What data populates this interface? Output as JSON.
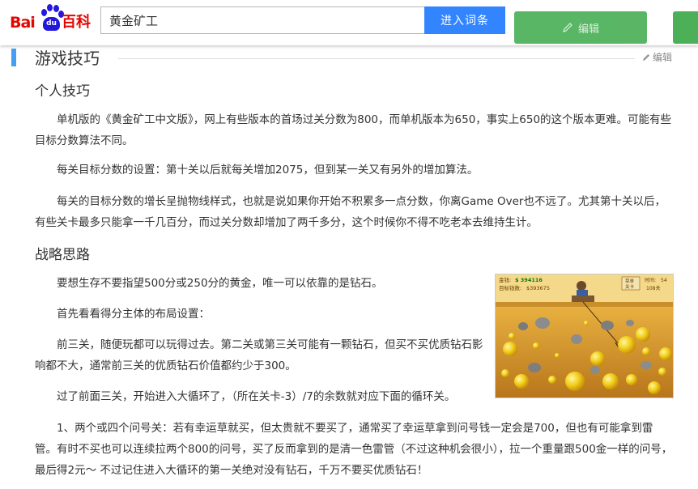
{
  "header": {
    "logo_left": "Bai",
    "logo_du": "du",
    "logo_right": "百科",
    "search_value": "黄金矿工",
    "search_button": "进入词条",
    "edit_button": "编辑"
  },
  "section": {
    "title": "游戏技巧",
    "edit_label": "编辑"
  },
  "subsections": [
    {
      "title": "个人技巧",
      "paragraphs": [
        "单机版的《黄金矿工中文版》，网上有些版本的首场过关分数为800，而单机版本为650，事实上650的这个版本更难。可能有些目标分数算法不同。",
        "每关目标分数的设置：第十关以后就每关增加2075，但到某一关又有另外的增加算法。",
        "每关的目标分数的增长呈抛物线样式，也就是说如果你开始不积累多一点分数，你离Game Over也不远了。尤其第十关以后，有些关卡最多只能拿一千几百分，而过关分数却增加了两千多分，这个时候你不得不吃老本去维持生计。"
      ]
    },
    {
      "title": "战略思路",
      "paragraphs": [
        "要想生存不要指望500分或250分的黄金，唯一可以依靠的是钻石。",
        "首先看看得分主体的布局设置：",
        "前三关，随便玩都可以玩得过去。第二关或第三关可能有一颗钻石，但买不买优质钻石影响都不大，通常前三关的优质钻石价值都约少于300。",
        "过了前面三关，开始进入大循环了，（所在关卡-3）/7的余数就对应下面的循环关。",
        "1、两个或四个问号关：若有幸运草就买，但太贵就不要买了，通常买了幸运草拿到问号钱一定会是700，但也有可能拿到雷管。有时不买也可以连续拉两个800的问号，买了反而拿到的是清一色雷管（不过这种机会很小），拉一个重量跟500金一样的问号，最后得2元～ 不过记住进入大循环的第一关绝对没有钻石，千万不要买优质钻石！"
      ]
    }
  ],
  "game_image": {
    "money_label": "金钱:",
    "money_value": "$ 394116",
    "goal_label": "目标钱数:",
    "goal_value": "$393675",
    "menu_label": "菜单",
    "level_label": "关卡",
    "time_label": "时间:",
    "time_value": "54",
    "level_value": "108关"
  },
  "colors": {
    "logo_red": "#e10601",
    "logo_blue": "#2319dc",
    "search_button": "#3385ff",
    "edit_button": "#4cb058",
    "section_bar": "#459df5"
  }
}
